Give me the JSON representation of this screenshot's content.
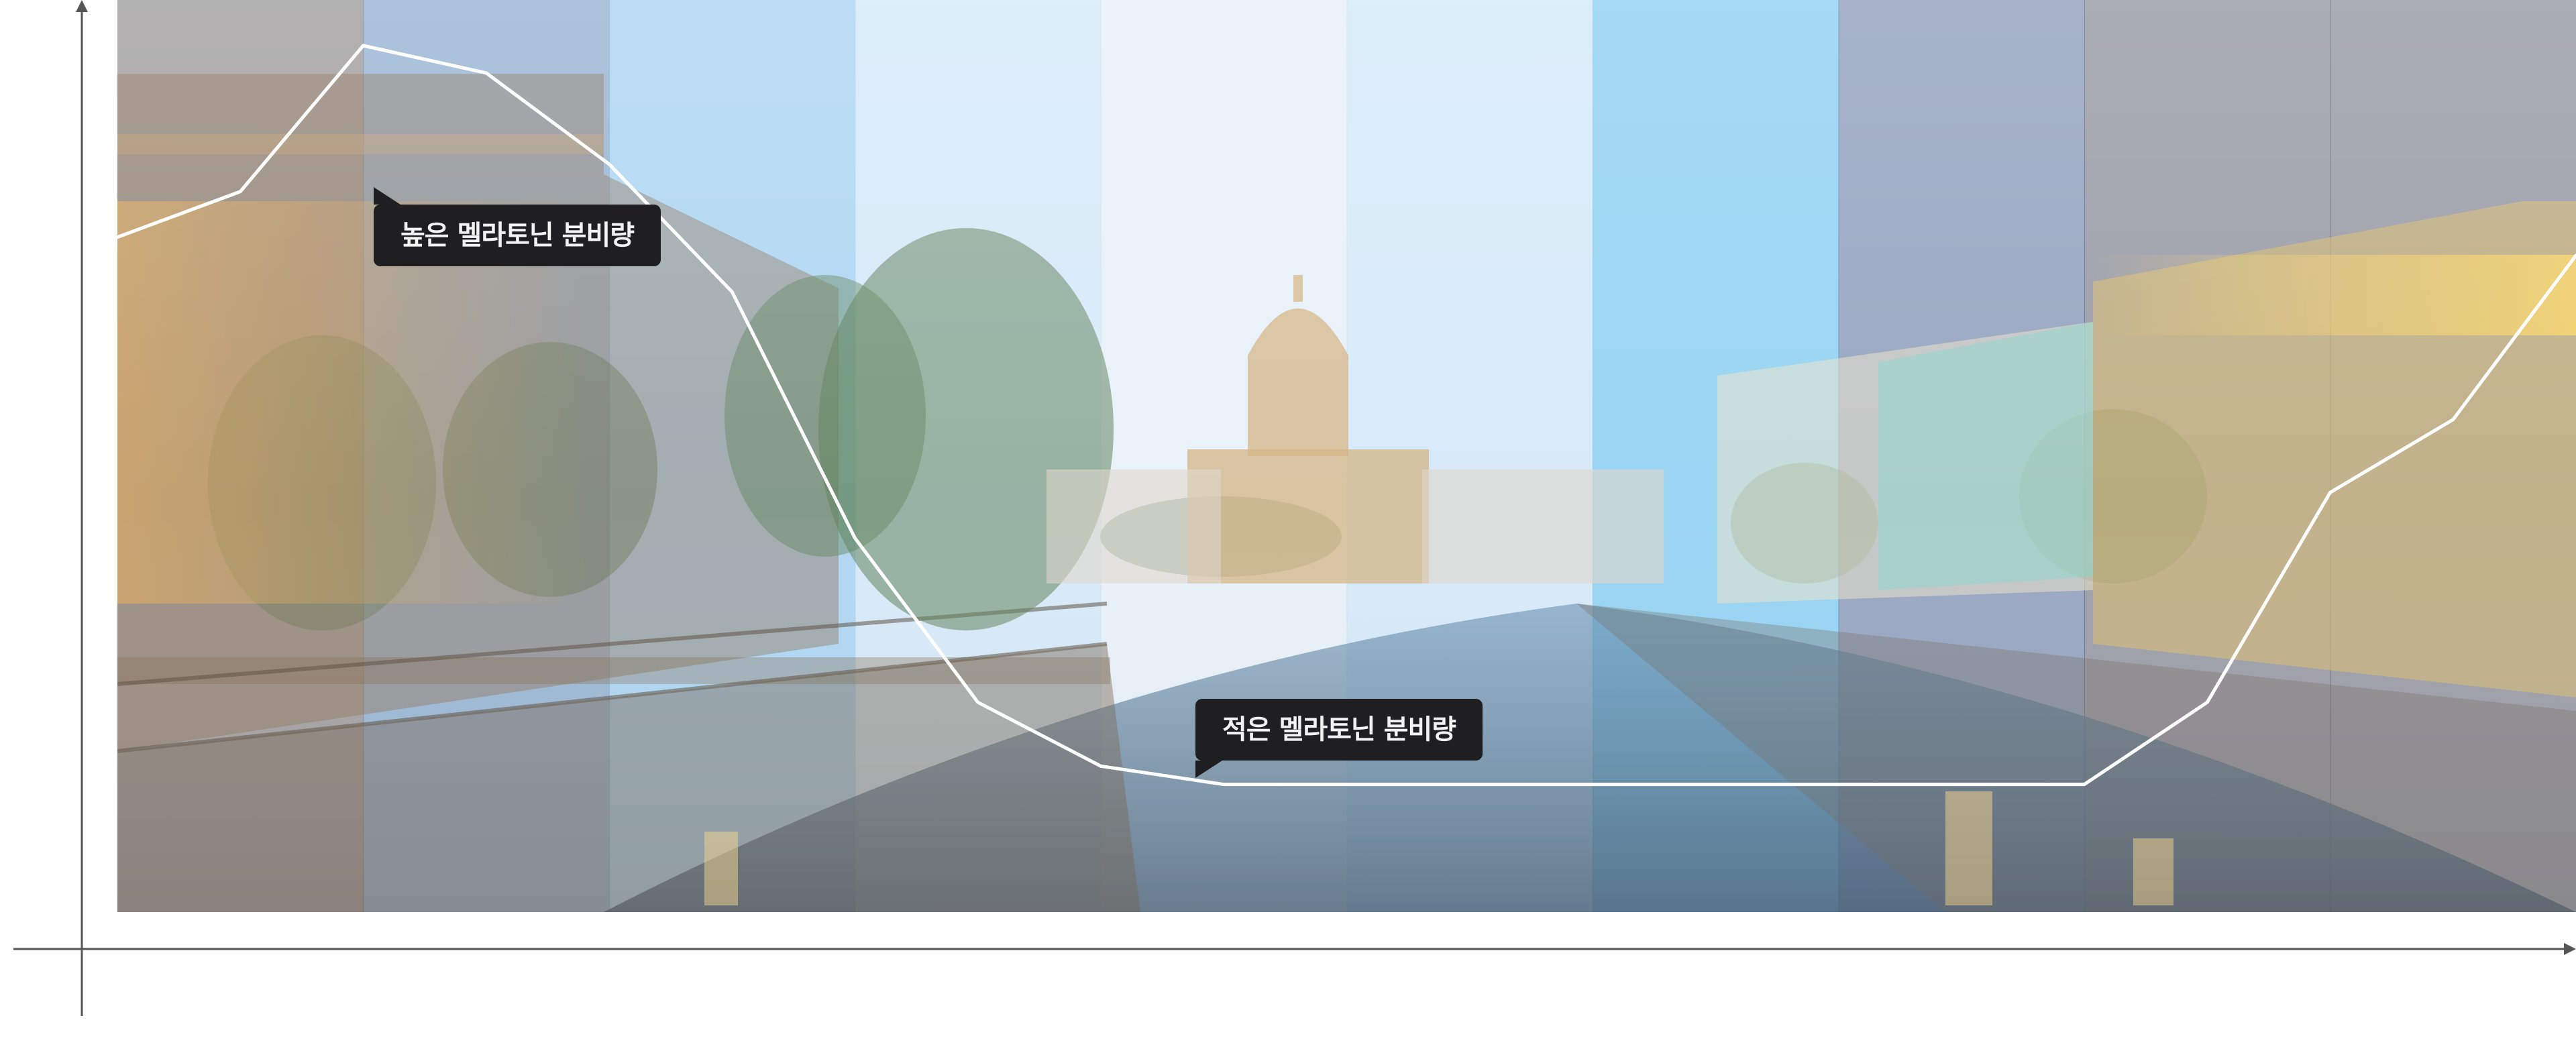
{
  "chart_data": {
    "type": "line",
    "title": "",
    "xlabel": "",
    "ylabel": "",
    "x": [
      0,
      1,
      2,
      3,
      4,
      5,
      6,
      7,
      8,
      9,
      10,
      11,
      12,
      13,
      14,
      15,
      16,
      17,
      18,
      19,
      20
    ],
    "y": [
      0.74,
      0.79,
      0.95,
      0.92,
      0.82,
      0.68,
      0.41,
      0.23,
      0.16,
      0.14,
      0.14,
      0.14,
      0.14,
      0.14,
      0.14,
      0.14,
      0.14,
      0.23,
      0.46,
      0.54,
      0.72
    ],
    "xlim": [
      0,
      20
    ],
    "ylim": [
      0,
      1
    ],
    "grid": false,
    "legend": "none",
    "background_bands": {
      "count": 10,
      "colors": [
        "#3e3b3b",
        "#2f67a6",
        "#58a9e6",
        "#a9d1f2",
        "#cfe2f3",
        "#a9d1f2",
        "#1fa3e6",
        "#1f3f7a",
        "#2b2f45",
        "#2b2f45"
      ],
      "scene": "city canal at sunset with domed cathedral"
    },
    "annotations": [
      {
        "text": "높은 멜라토닌 분비량",
        "x": 2,
        "y": 0.95
      },
      {
        "text": "적은 멜라토닌 분비량",
        "x": 8.5,
        "y": 0.15
      }
    ],
    "colors": {
      "line": "#ffffff",
      "axis": "#555555",
      "callout_bg": "#1f1f22",
      "callout_text": "#f2f2f2"
    }
  }
}
